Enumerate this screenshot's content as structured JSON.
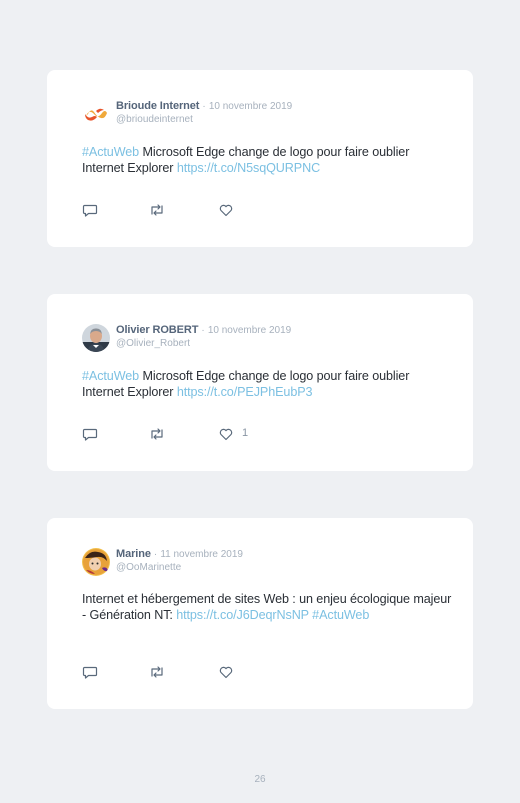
{
  "tweets": [
    {
      "display_name": "Brioude Internet",
      "separator": "·",
      "date": "10 novembre 2019",
      "handle": "@brioudeinternet",
      "avatar_icon": "brioude-logo-icon",
      "text_parts": [
        {
          "type": "hashtag",
          "text": "#ActuWeb"
        },
        {
          "type": "text",
          "text": " Microsoft Edge change de logo pour faire oublier Internet Explorer "
        },
        {
          "type": "link",
          "text": "https://t.co/N5sqQURPNC"
        }
      ],
      "like_count": ""
    },
    {
      "display_name": "Olivier ROBERT",
      "separator": "·",
      "date": "10 novembre 2019",
      "handle": "@Olivier_Robert",
      "avatar_icon": "user-photo-icon",
      "text_parts": [
        {
          "type": "hashtag",
          "text": "#ActuWeb"
        },
        {
          "type": "text",
          "text": " Microsoft Edge change de logo pour faire oublier Internet Explorer "
        },
        {
          "type": "link",
          "text": "https://t.co/PEJPhEubP3"
        }
      ],
      "like_count": "1"
    },
    {
      "display_name": "Marine",
      "separator": "·",
      "date": "11 novembre 2019",
      "handle": "@OoMarinette",
      "avatar_icon": "user-photo-icon",
      "text_parts": [
        {
          "type": "text",
          "text": "Internet et hébergement de sites Web : un enjeu écologique majeur - Génération NT: "
        },
        {
          "type": "link",
          "text": "https://t.co/J6DeqrNsNP"
        },
        {
          "type": "text",
          "text": " "
        },
        {
          "type": "hashtag",
          "text": "#ActuWeb"
        }
      ],
      "like_count": ""
    }
  ],
  "page_number": "26",
  "colors": {
    "background": "#eef0f3",
    "card": "#ffffff",
    "name": "#55657a",
    "muted": "#a7b1bd",
    "link": "#7cc0e2",
    "text": "#2a2f36"
  }
}
